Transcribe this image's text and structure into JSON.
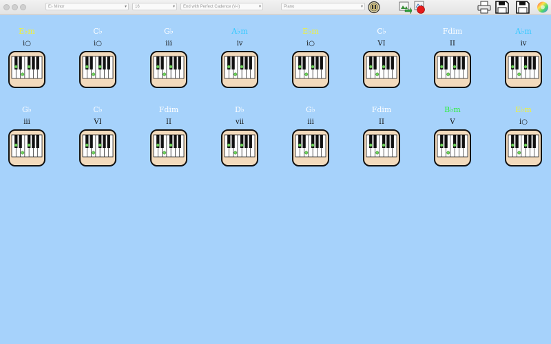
{
  "toolbar": {
    "key_select": "E♭ Minor",
    "count_select": "16",
    "cadence_select": "End with Perfect Cadence (V-I)",
    "instrument_select": "Piano",
    "icons": [
      "metronome-icon",
      "export-icon",
      "record-icon",
      "print-icon",
      "save-icon",
      "save-as-icon",
      "color-wheel-icon"
    ]
  },
  "colors": {
    "background": "#a6d2fb",
    "white": "#ffffff",
    "yellow": "#f5f232",
    "cyan": "#33c9ff",
    "green": "#2dee3c"
  },
  "chords": [
    {
      "name": "E♭m",
      "degree": "i○",
      "color": "yellow"
    },
    {
      "name": "C♭",
      "degree": "i○",
      "color": "white"
    },
    {
      "name": "G♭",
      "degree": "iii",
      "color": "white"
    },
    {
      "name": "A♭m",
      "degree": "iv",
      "color": "cyan"
    },
    {
      "name": "E♭m",
      "degree": "i○",
      "color": "yellow"
    },
    {
      "name": "C♭",
      "degree": "VI",
      "color": "white"
    },
    {
      "name": "Fdim",
      "degree": "II",
      "color": "white"
    },
    {
      "name": "A♭m",
      "degree": "iv",
      "color": "cyan"
    },
    {
      "name": "G♭",
      "degree": "iii",
      "color": "white"
    },
    {
      "name": "C♭",
      "degree": "VI",
      "color": "white"
    },
    {
      "name": "Fdim",
      "degree": "II",
      "color": "white"
    },
    {
      "name": "D♭",
      "degree": "vii",
      "color": "white"
    },
    {
      "name": "G♭",
      "degree": "iii",
      "color": "white"
    },
    {
      "name": "Fdim",
      "degree": "II",
      "color": "white"
    },
    {
      "name": "B♭m",
      "degree": "V",
      "color": "green"
    },
    {
      "name": "E♭m",
      "degree": "i○",
      "color": "yellow"
    }
  ]
}
